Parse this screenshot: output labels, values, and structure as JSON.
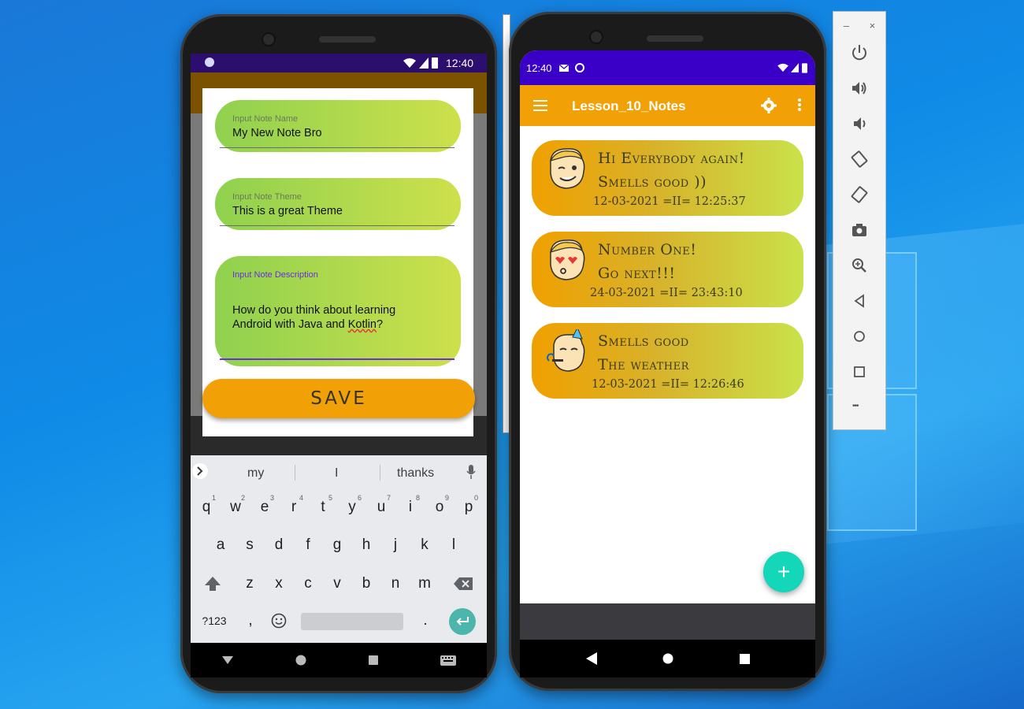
{
  "left_phone": {
    "status_time": "12:40",
    "fields": [
      {
        "label": "Input Note Name",
        "value": "My New Note Bro"
      },
      {
        "label": "Input Note Theme",
        "value": "This is a great Theme"
      },
      {
        "label": "Input Note Description",
        "value_line1": "How do you think about learning",
        "value_line2_a": "Android with Java and ",
        "value_line2_b": "Kotlin",
        "value_line2_c": "?"
      }
    ],
    "save_label": "SAVE",
    "suggestions": [
      "my",
      "I",
      "thanks"
    ],
    "keyboard": {
      "row1": [
        "q",
        "w",
        "e",
        "r",
        "t",
        "y",
        "u",
        "i",
        "o",
        "p"
      ],
      "row1_sup": [
        "1",
        "2",
        "3",
        "4",
        "5",
        "6",
        "7",
        "8",
        "9",
        "0"
      ],
      "row2": [
        "a",
        "s",
        "d",
        "f",
        "g",
        "h",
        "j",
        "k",
        "l"
      ],
      "row3": [
        "z",
        "x",
        "c",
        "v",
        "b",
        "n",
        "m"
      ],
      "symbols_key": "?123",
      "comma": ",",
      "period": "."
    }
  },
  "right_phone": {
    "status_time": "12:40",
    "app_title": "Lesson_10_Notes",
    "notes": [
      {
        "line1": "Hi Everybody again!",
        "line2": "Smells good ))",
        "date": "12-03-2021 =II= 12:25:37"
      },
      {
        "line1": "Number One!",
        "line2": "Go next!!!",
        "date": "24-03-2021 =II= 23:43:10"
      },
      {
        "line1": "Smells good",
        "line2": "The weather",
        "date": "12-03-2021 =II= 12:26:46"
      }
    ],
    "fab_label": "+"
  },
  "emulator_toolbar": {
    "minimize": "–",
    "close": "×",
    "more": "•••"
  },
  "colors": {
    "accent_orange": "#f1a005",
    "status_purple": "#3a00c8",
    "fab_teal": "#14d6b8",
    "field_green": "#8fd14f"
  }
}
